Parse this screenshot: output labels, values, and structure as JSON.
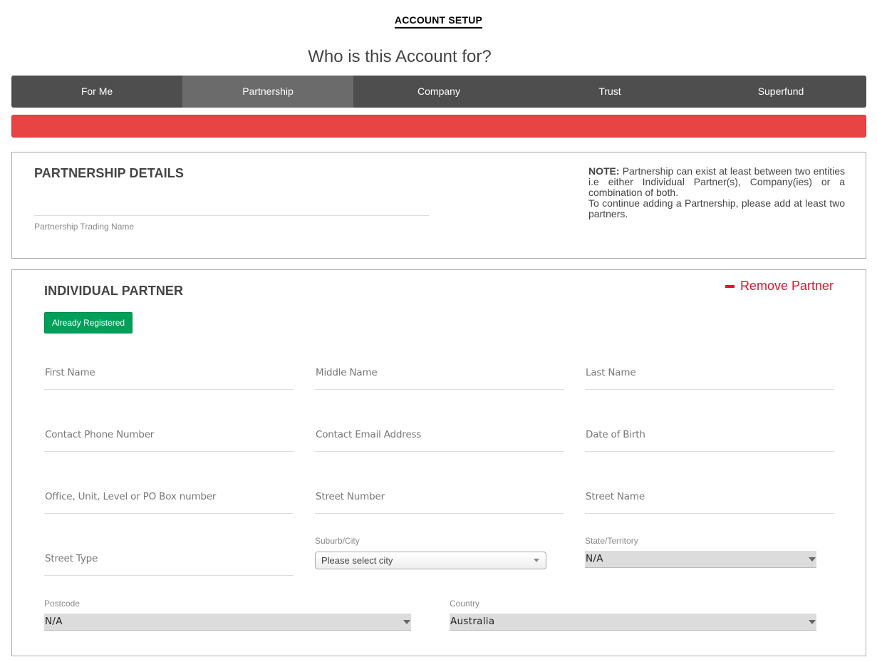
{
  "header": {
    "title": "ACCOUNT SETUP",
    "question": "Who is this Account for?"
  },
  "tabs": [
    {
      "label": "For Me",
      "active": false
    },
    {
      "label": "Partnership",
      "active": true
    },
    {
      "label": "Company",
      "active": false
    },
    {
      "label": "Trust",
      "active": false
    },
    {
      "label": "Superfund",
      "active": false
    }
  ],
  "colors": {
    "tab_bar": "#4e4e4e",
    "tab_active": "#6b6b6b",
    "alert": "#e94444",
    "success_button": "#00a05a",
    "remove_link": "#e8112d"
  },
  "partnership": {
    "title": "PARTNERSHIP DETAILS",
    "trading_name_label": "Partnership Trading Name",
    "note_bold": "NOTE:",
    "note_text": " Partnership can exist at least between two entities i.e either Individual Partner(s), Company(ies) or a combination of both.",
    "note_text_2": "To continue adding a Partnership, please add at least two partners."
  },
  "partner": {
    "title": "INDIVIDUAL PARTNER",
    "remove_label": "Remove Partner",
    "registered_button": "Already Registered",
    "fields": {
      "first_name": "First Name",
      "middle_name": "Middle Name",
      "last_name": "Last Name",
      "phone": "Contact Phone Number",
      "email": "Contact Email Address",
      "dob": "Date of Birth",
      "office_unit": "Office, Unit, Level or PO Box number",
      "street_number": "Street Number",
      "street_name": "Street Name",
      "street_type": "Street Type"
    },
    "suburb": {
      "label": "Suburb/City",
      "value": "Please select city"
    },
    "state": {
      "label": "State/Territory",
      "value": "N/A"
    },
    "postcode": {
      "label": "Postcode",
      "value": "N/A"
    },
    "country": {
      "label": "Country",
      "value": "Australia"
    }
  }
}
